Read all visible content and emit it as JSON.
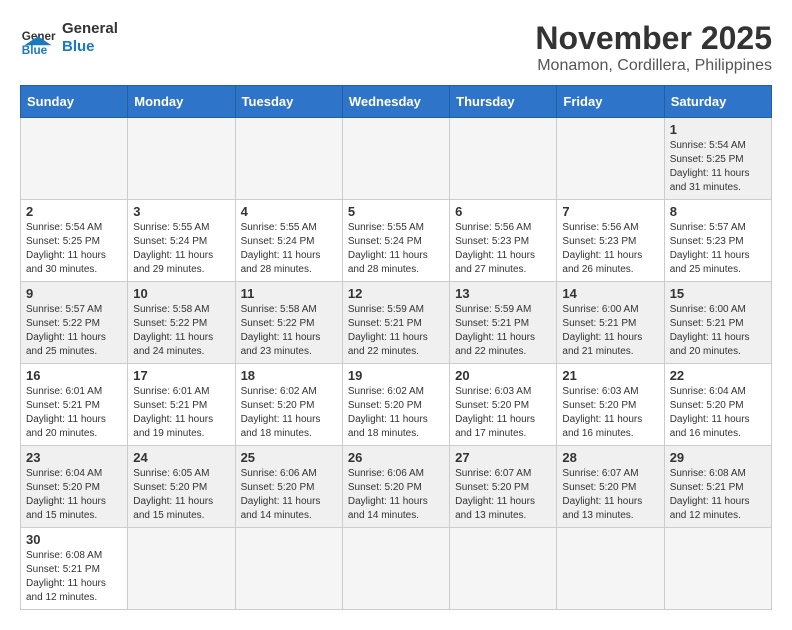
{
  "header": {
    "logo_general": "General",
    "logo_blue": "Blue",
    "month_title": "November 2025",
    "location": "Monamon, Cordillera, Philippines"
  },
  "weekdays": [
    "Sunday",
    "Monday",
    "Tuesday",
    "Wednesday",
    "Thursday",
    "Friday",
    "Saturday"
  ],
  "weeks": [
    [
      {
        "day": "",
        "info": ""
      },
      {
        "day": "",
        "info": ""
      },
      {
        "day": "",
        "info": ""
      },
      {
        "day": "",
        "info": ""
      },
      {
        "day": "",
        "info": ""
      },
      {
        "day": "",
        "info": ""
      },
      {
        "day": "1",
        "info": "Sunrise: 5:54 AM\nSunset: 5:25 PM\nDaylight: 11 hours\nand 31 minutes."
      }
    ],
    [
      {
        "day": "2",
        "info": "Sunrise: 5:54 AM\nSunset: 5:25 PM\nDaylight: 11 hours\nand 30 minutes."
      },
      {
        "day": "3",
        "info": "Sunrise: 5:55 AM\nSunset: 5:24 PM\nDaylight: 11 hours\nand 29 minutes."
      },
      {
        "day": "4",
        "info": "Sunrise: 5:55 AM\nSunset: 5:24 PM\nDaylight: 11 hours\nand 28 minutes."
      },
      {
        "day": "5",
        "info": "Sunrise: 5:55 AM\nSunset: 5:24 PM\nDaylight: 11 hours\nand 28 minutes."
      },
      {
        "day": "6",
        "info": "Sunrise: 5:56 AM\nSunset: 5:23 PM\nDaylight: 11 hours\nand 27 minutes."
      },
      {
        "day": "7",
        "info": "Sunrise: 5:56 AM\nSunset: 5:23 PM\nDaylight: 11 hours\nand 26 minutes."
      },
      {
        "day": "8",
        "info": "Sunrise: 5:57 AM\nSunset: 5:23 PM\nDaylight: 11 hours\nand 25 minutes."
      }
    ],
    [
      {
        "day": "9",
        "info": "Sunrise: 5:57 AM\nSunset: 5:22 PM\nDaylight: 11 hours\nand 25 minutes."
      },
      {
        "day": "10",
        "info": "Sunrise: 5:58 AM\nSunset: 5:22 PM\nDaylight: 11 hours\nand 24 minutes."
      },
      {
        "day": "11",
        "info": "Sunrise: 5:58 AM\nSunset: 5:22 PM\nDaylight: 11 hours\nand 23 minutes."
      },
      {
        "day": "12",
        "info": "Sunrise: 5:59 AM\nSunset: 5:21 PM\nDaylight: 11 hours\nand 22 minutes."
      },
      {
        "day": "13",
        "info": "Sunrise: 5:59 AM\nSunset: 5:21 PM\nDaylight: 11 hours\nand 22 minutes."
      },
      {
        "day": "14",
        "info": "Sunrise: 6:00 AM\nSunset: 5:21 PM\nDaylight: 11 hours\nand 21 minutes."
      },
      {
        "day": "15",
        "info": "Sunrise: 6:00 AM\nSunset: 5:21 PM\nDaylight: 11 hours\nand 20 minutes."
      }
    ],
    [
      {
        "day": "16",
        "info": "Sunrise: 6:01 AM\nSunset: 5:21 PM\nDaylight: 11 hours\nand 20 minutes."
      },
      {
        "day": "17",
        "info": "Sunrise: 6:01 AM\nSunset: 5:21 PM\nDaylight: 11 hours\nand 19 minutes."
      },
      {
        "day": "18",
        "info": "Sunrise: 6:02 AM\nSunset: 5:20 PM\nDaylight: 11 hours\nand 18 minutes."
      },
      {
        "day": "19",
        "info": "Sunrise: 6:02 AM\nSunset: 5:20 PM\nDaylight: 11 hours\nand 18 minutes."
      },
      {
        "day": "20",
        "info": "Sunrise: 6:03 AM\nSunset: 5:20 PM\nDaylight: 11 hours\nand 17 minutes."
      },
      {
        "day": "21",
        "info": "Sunrise: 6:03 AM\nSunset: 5:20 PM\nDaylight: 11 hours\nand 16 minutes."
      },
      {
        "day": "22",
        "info": "Sunrise: 6:04 AM\nSunset: 5:20 PM\nDaylight: 11 hours\nand 16 minutes."
      }
    ],
    [
      {
        "day": "23",
        "info": "Sunrise: 6:04 AM\nSunset: 5:20 PM\nDaylight: 11 hours\nand 15 minutes."
      },
      {
        "day": "24",
        "info": "Sunrise: 6:05 AM\nSunset: 5:20 PM\nDaylight: 11 hours\nand 15 minutes."
      },
      {
        "day": "25",
        "info": "Sunrise: 6:06 AM\nSunset: 5:20 PM\nDaylight: 11 hours\nand 14 minutes."
      },
      {
        "day": "26",
        "info": "Sunrise: 6:06 AM\nSunset: 5:20 PM\nDaylight: 11 hours\nand 14 minutes."
      },
      {
        "day": "27",
        "info": "Sunrise: 6:07 AM\nSunset: 5:20 PM\nDaylight: 11 hours\nand 13 minutes."
      },
      {
        "day": "28",
        "info": "Sunrise: 6:07 AM\nSunset: 5:20 PM\nDaylight: 11 hours\nand 13 minutes."
      },
      {
        "day": "29",
        "info": "Sunrise: 6:08 AM\nSunset: 5:21 PM\nDaylight: 11 hours\nand 12 minutes."
      }
    ],
    [
      {
        "day": "30",
        "info": "Sunrise: 6:08 AM\nSunset: 5:21 PM\nDaylight: 11 hours\nand 12 minutes."
      },
      {
        "day": "",
        "info": ""
      },
      {
        "day": "",
        "info": ""
      },
      {
        "day": "",
        "info": ""
      },
      {
        "day": "",
        "info": ""
      },
      {
        "day": "",
        "info": ""
      },
      {
        "day": "",
        "info": ""
      }
    ]
  ]
}
